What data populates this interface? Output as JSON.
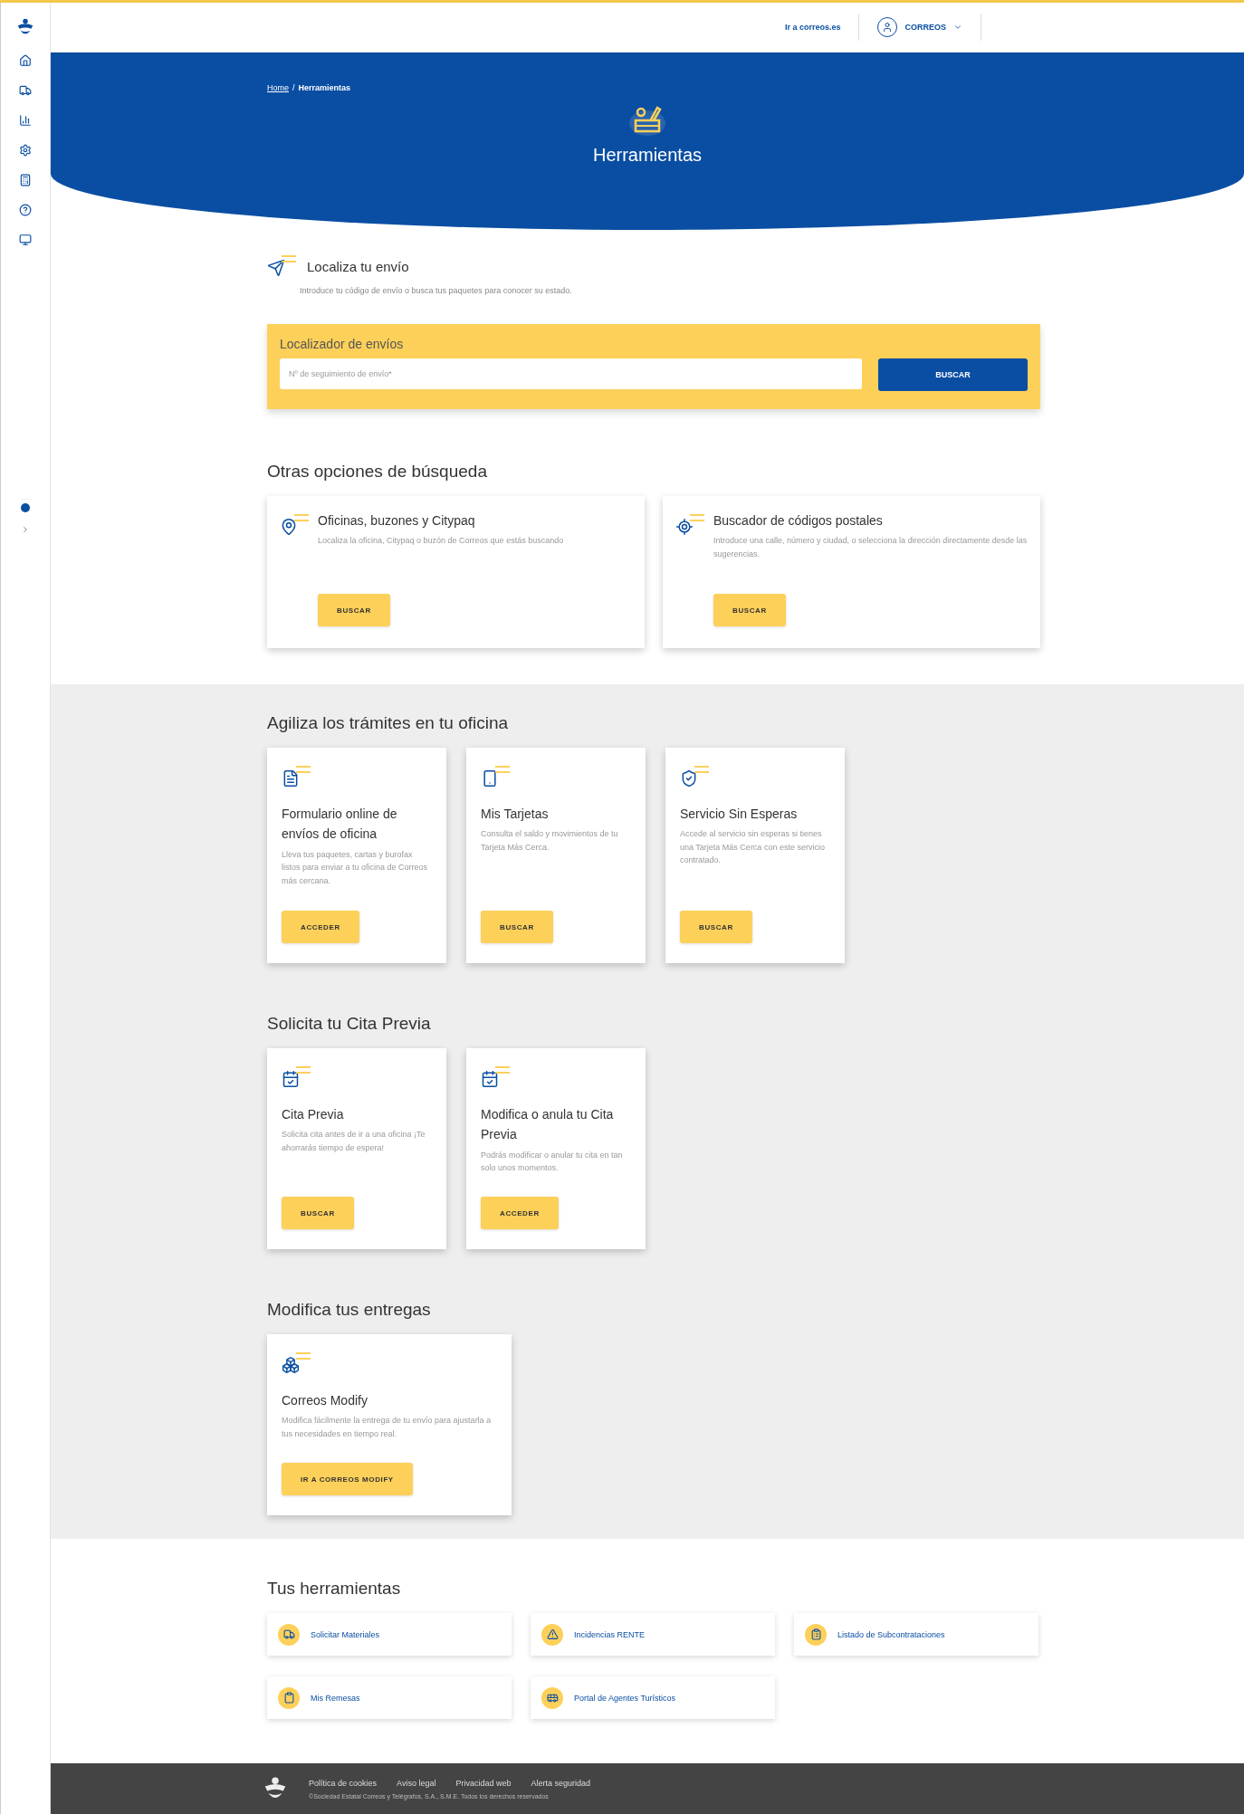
{
  "header": {
    "link": "Ir a correos.es",
    "user": "CORREOS"
  },
  "breadcrumb": {
    "items": [
      "Home",
      "Herramientas"
    ],
    "separator": "/"
  },
  "hero": {
    "title": "Herramientas"
  },
  "locate": {
    "title": "Localiza tu envío",
    "description": "Introduce tu código de envío o busca tus paquetes para conocer su estado.",
    "panel_title": "Localizador de envíos",
    "placeholder": "Nº de seguimiento de envío*",
    "button": "BUSCAR"
  },
  "search_options": {
    "title": "Otras opciones de búsqueda",
    "cards": [
      {
        "title": "Oficinas, buzones y Citypaq",
        "description": "Localiza la oficina, Citypaq o buzón de Correos que estás buscando",
        "button": "BUSCAR"
      },
      {
        "title": "Buscador de códigos postales",
        "description": "Introduce una calle, número y ciudad, o selecciona la dirección directamente desde las sugerencias.",
        "button": "BUSCAR"
      }
    ]
  },
  "office_sections": [
    {
      "title": "Agiliza los trámites en tu oficina",
      "cards": [
        {
          "title": "Formulario online de envíos de oficina",
          "description": "Lleva tus paquetes, cartas y burofax listos para enviar a tu oficina de Correos más cercana.",
          "button": "ACCEDER"
        },
        {
          "title": "Mis Tarjetas",
          "description": "Consulta el saldo y movimientos de tu Tarjeta Más Cerca.",
          "button": "BUSCAR"
        },
        {
          "title": "Servicio Sin Esperas",
          "description": "Accede al servicio sin esperas si tienes una Tarjeta Más Cerca con este servicio contratado.",
          "button": "BUSCAR"
        }
      ]
    },
    {
      "title": "Solicita tu Cita Previa",
      "cards": [
        {
          "title": "Cita Previa",
          "description": "Solicita cita antes de ir a una oficina ¡Te ahorrarás tiempo de espera!",
          "button": "BUSCAR"
        },
        {
          "title": "Modifica o anula tu Cita Previa",
          "description": "Podrás modificar o anular tu cita en tan solo unos momentos.",
          "button": "ACCEDER"
        }
      ]
    },
    {
      "title": "Modifica tus entregas",
      "cards": [
        {
          "title": "Correos Modify",
          "description": "Modifica fácilmente la entrega de tu envío para ajustarla a tus necesidades en tiempo real.",
          "button": "IR A CORREOS MODIFY"
        }
      ]
    }
  ],
  "tools": {
    "title": "Tus herramientas",
    "items": [
      "Solicitar Materiales",
      "Incidencias RENTE",
      "Listado de Subcontrataciones",
      "Mis Remesas",
      "Portal de Agentes Turísticos"
    ]
  },
  "footer": {
    "links": [
      "Política de cookies",
      "Aviso legal",
      "Privacidad web",
      "Alerta seguridad"
    ],
    "copyright": "©Sociedad Estatal Correos y Telégrafos, S.A., S.M.E. Todos los derechos reservados"
  }
}
